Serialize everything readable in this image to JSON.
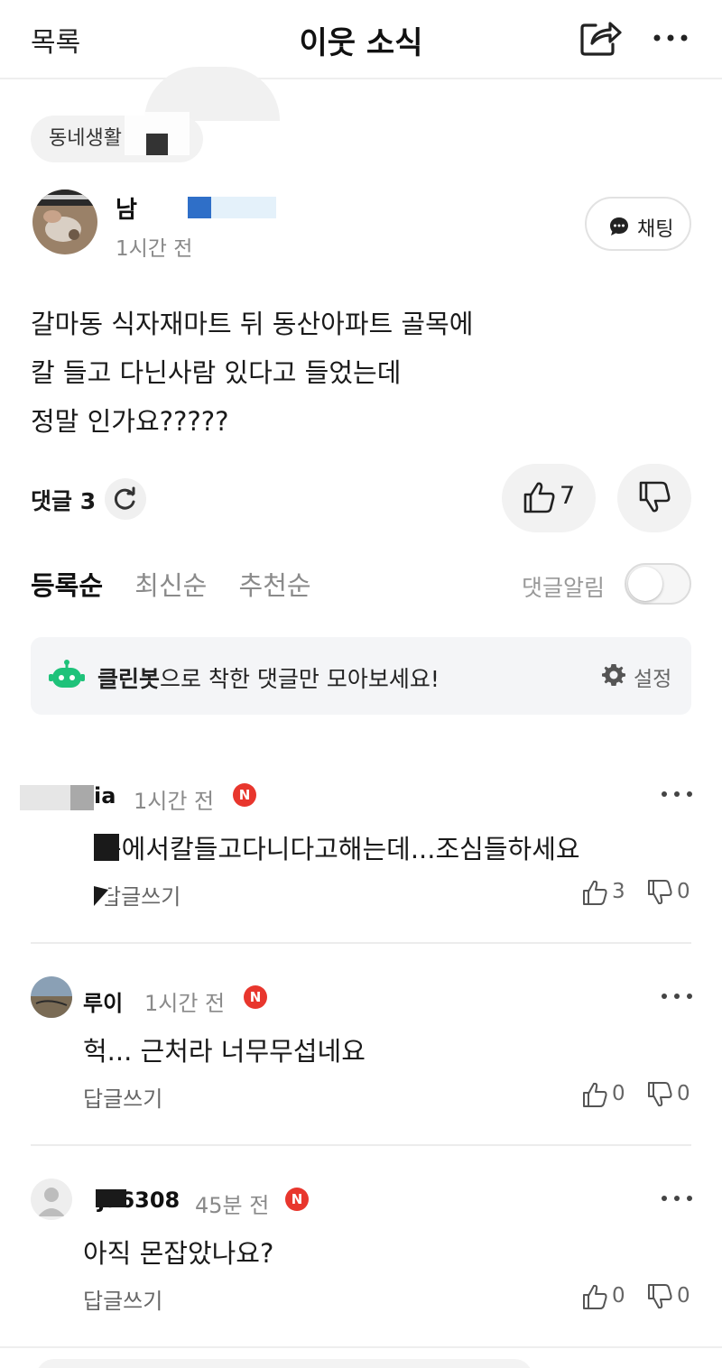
{
  "header": {
    "back_label": "목록",
    "title": "이웃 소식"
  },
  "post": {
    "category": "동네생활",
    "author": "남",
    "time": "1시간 전",
    "chat_label": "채팅",
    "body_lines": [
      "갈마동 식자재마트 뒤 동산아파트 골목에",
      "칼 들고 다닌사람 있다고 들었는데",
      "정말 인가요?????"
    ],
    "comments_label": "댓글 3",
    "like_count": "7"
  },
  "sort": {
    "tabs": [
      "등록순",
      "최신순",
      "추천순"
    ],
    "active": "등록순",
    "notify_label": "댓글알림",
    "notify_on": false
  },
  "cleanbot": {
    "brand": "클린봇",
    "message": "으로 착한 댓글만 모아보세요!",
    "settings_label": "설정"
  },
  "comments": [
    {
      "name": "ia",
      "time": "1시간 전",
      "badge": "N",
      "text": "동에서칼들고다니다고해는데...조심들하세요",
      "reply_label": "답글쓰기",
      "likes": "3",
      "dislikes": "0"
    },
    {
      "name": "루이",
      "time": "1시간 전",
      "badge": "N",
      "text": "헉... 근처라 너무무섭네요",
      "reply_label": "답글쓰기",
      "likes": "0",
      "dislikes": "0"
    },
    {
      "name": "ja6308",
      "time": "45분 전",
      "badge": "N",
      "text": "아직 몬잡았나요?",
      "reply_label": "답글쓰기",
      "likes": "0",
      "dislikes": "0"
    }
  ],
  "colors": {
    "badge_red": "#e8362d",
    "bot_green": "#1ec27a",
    "redact_blue": "#2f6fc8"
  }
}
